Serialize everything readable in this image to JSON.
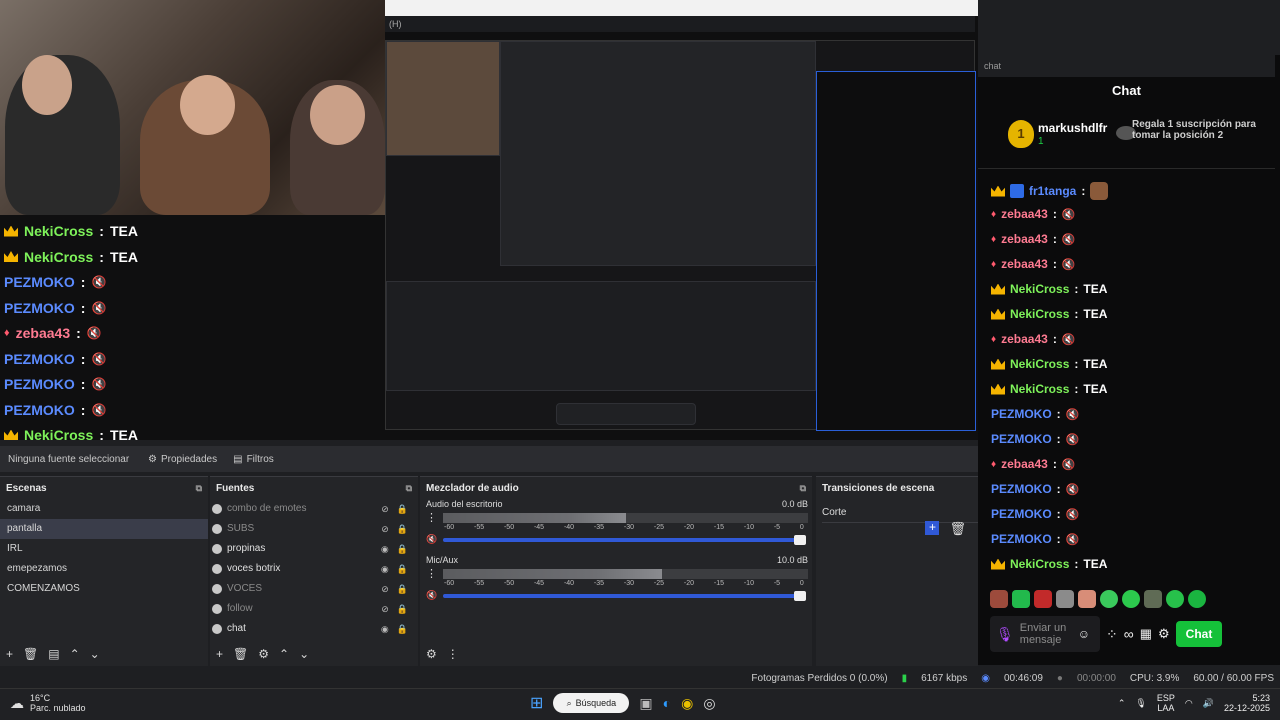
{
  "menubar": {
    "text": "(H)"
  },
  "overlay_chat": [
    {
      "name": "NekiCross",
      "text": "TEA",
      "kind": "crown-green"
    },
    {
      "name": "NekiCross",
      "text": "TEA",
      "kind": "crown-green"
    },
    {
      "name": "PEZMOKO",
      "text": "",
      "kind": "blue"
    },
    {
      "name": "PEZMOKO",
      "text": "",
      "kind": "blue"
    },
    {
      "name": "zebaa43",
      "text": "",
      "kind": "red"
    },
    {
      "name": "PEZMOKO",
      "text": "",
      "kind": "blue"
    },
    {
      "name": "PEZMOKO",
      "text": "",
      "kind": "blue"
    },
    {
      "name": "PEZMOKO",
      "text": "",
      "kind": "blue"
    },
    {
      "name": "NekiCross",
      "text": "TEA",
      "kind": "crown-green"
    }
  ],
  "props_bar": {
    "no_source": "Ninguna fuente seleccionar",
    "properties": "Propiedades",
    "filters": "Filtros"
  },
  "scenes": {
    "title": "Escenas",
    "items": [
      "camara",
      "pantalla",
      "IRL",
      "emepezamos",
      "COMENZAMOS"
    ],
    "selected": 1
  },
  "sources": {
    "title": "Fuentes",
    "items": [
      "combo de emotes",
      "SUBS",
      "propinas",
      "voces botrix",
      "VOCES",
      "follow",
      "chat"
    ]
  },
  "mixer": {
    "title": "Mezclador de audio",
    "channels": [
      {
        "name": "Audio del escritorio",
        "db": "0.0 dB",
        "level": 0.5
      },
      {
        "name": "Mic/Aux",
        "db": "10.0 dB",
        "level": 0.6
      }
    ],
    "scale": [
      "-60",
      "-55",
      "-50",
      "-45",
      "-40",
      "-35",
      "-30",
      "-25",
      "-20",
      "-15",
      "-10",
      "-5",
      "0"
    ]
  },
  "transitions": {
    "title": "Transiciones de escena",
    "current": "Corte"
  },
  "chat": {
    "url": "chat",
    "header": "Chat",
    "top_user": "markushdlfr",
    "top_count": "1",
    "gift_text": "Regala 1 suscripción para tomar la posición 2",
    "messages": [
      {
        "name": "fr1tanga",
        "text": "",
        "kind": "gold"
      },
      {
        "name": "zebaa43",
        "text": "",
        "kind": "red"
      },
      {
        "name": "zebaa43",
        "text": "",
        "kind": "red"
      },
      {
        "name": "zebaa43",
        "text": "",
        "kind": "red"
      },
      {
        "name": "NekiCross",
        "text": "TEA",
        "kind": "crown-green"
      },
      {
        "name": "NekiCross",
        "text": "TEA",
        "kind": "crown-green"
      },
      {
        "name": "zebaa43",
        "text": "",
        "kind": "red"
      },
      {
        "name": "NekiCross",
        "text": "TEA",
        "kind": "crown-green"
      },
      {
        "name": "NekiCross",
        "text": "TEA",
        "kind": "crown-green"
      },
      {
        "name": "PEZMOKO",
        "text": "",
        "kind": "blue"
      },
      {
        "name": "PEZMOKO",
        "text": "",
        "kind": "blue"
      },
      {
        "name": "zebaa43",
        "text": "",
        "kind": "red"
      },
      {
        "name": "PEZMOKO",
        "text": "",
        "kind": "blue"
      },
      {
        "name": "PEZMOKO",
        "text": "",
        "kind": "blue"
      },
      {
        "name": "PEZMOKO",
        "text": "",
        "kind": "blue"
      },
      {
        "name": "NekiCross",
        "text": "TEA",
        "kind": "crown-green"
      }
    ],
    "input_placeholder": "Enviar un mensaje",
    "send_label": "Chat"
  },
  "status": {
    "dropped": "Fotogramas Perdidos 0 (0.0%)",
    "kbps": "6167 kbps",
    "live": "00:46:09",
    "rec": "00:00:00",
    "cpu": "CPU: 3.9%",
    "fps": "60.00 / 60.00 FPS"
  },
  "taskbar": {
    "temp": "16°C",
    "weather": "Parc. nublado",
    "search": "Búsqueda",
    "lang": "ESP",
    "layout": "LAA",
    "time": "5:23",
    "date": "22-12-2025"
  },
  "colors": {
    "accent": "#3059d6",
    "green": "#15c13a",
    "crown": "#f5b400"
  }
}
